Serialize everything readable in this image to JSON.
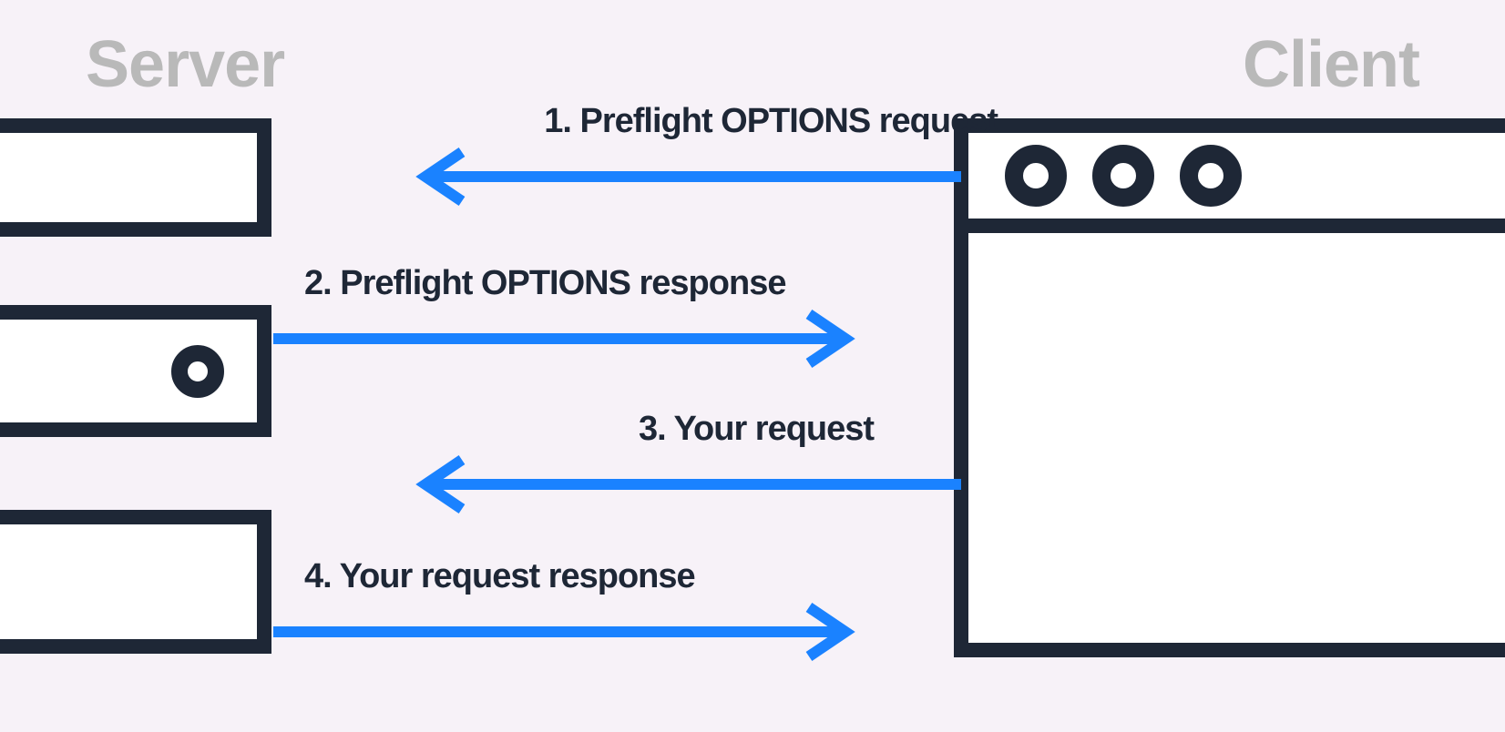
{
  "titles": {
    "server": "Server",
    "client": "Client"
  },
  "arrows": {
    "step1": "1. Preflight OPTIONS request",
    "step2": "2. Preflight OPTIONS response",
    "step3": "3. Your request",
    "step4": "4. Your request response"
  },
  "colors": {
    "background": "#f7f2f8",
    "stroke": "#1e2736",
    "arrow": "#1a82ff",
    "title": "#b9b9b9"
  }
}
